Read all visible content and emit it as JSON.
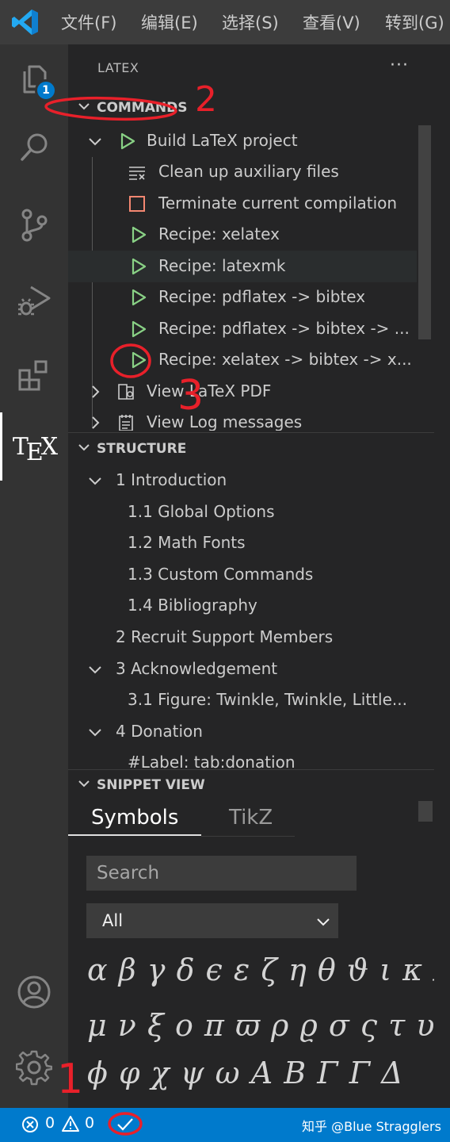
{
  "menubar": {
    "items": [
      "文件(F)",
      "编辑(E)",
      "选择(S)",
      "查看(V)",
      "转到(G)"
    ]
  },
  "activity": {
    "explorer_badge": "1",
    "tex_label": [
      "T",
      "E",
      "X"
    ]
  },
  "sidebar": {
    "title": "LATEX",
    "more": "···"
  },
  "commands": {
    "header": "COMMANDS",
    "items": [
      "Build LaTeX project",
      "Clean up auxiliary files",
      "Terminate current compilation",
      "Recipe: xelatex",
      "Recipe: latexmk",
      "Recipe: pdflatex -> bibtex",
      "Recipe: pdflatex -> bibtex -> ...",
      "Recipe: xelatex -> bibtex -> x...",
      "View LaTeX PDF",
      "View Log messages"
    ]
  },
  "structure": {
    "header": "STRUCTURE",
    "items": [
      "1 Introduction",
      "1.1 Global Options",
      "1.2 Math Fonts",
      "1.3 Custom Commands",
      "1.4 Bibliography",
      "2 Recruit Support Members",
      "3 Acknowledgement",
      "3.1 Figure:  Twinkle, Twinkle, Little...",
      "4 Donation",
      "#Label: tab:donation"
    ]
  },
  "snippet": {
    "header": "SNIPPET VIEW",
    "tabs": [
      "Symbols",
      "TikZ"
    ],
    "search_placeholder": "Search",
    "filter_value": "All",
    "symbols_rows": [
      "α β γ δ ϵ ε ζ η θ ϑ ι κ λ",
      "μ ν ξ o π ϖ ρ ϱ σ ς τ υ",
      "ϕ φ χ ψ ω A B Γ Γ Δ"
    ]
  },
  "statusbar": {
    "errors": "0",
    "warnings": "0",
    "watermark": "知乎 @Blue Stragglers"
  },
  "annotations": [
    "2",
    "3",
    "1"
  ],
  "colors": {
    "accent": "#007acc",
    "run_green": "#89d185",
    "stop_red": "#f48771",
    "annotation_red": "#e8202a"
  }
}
